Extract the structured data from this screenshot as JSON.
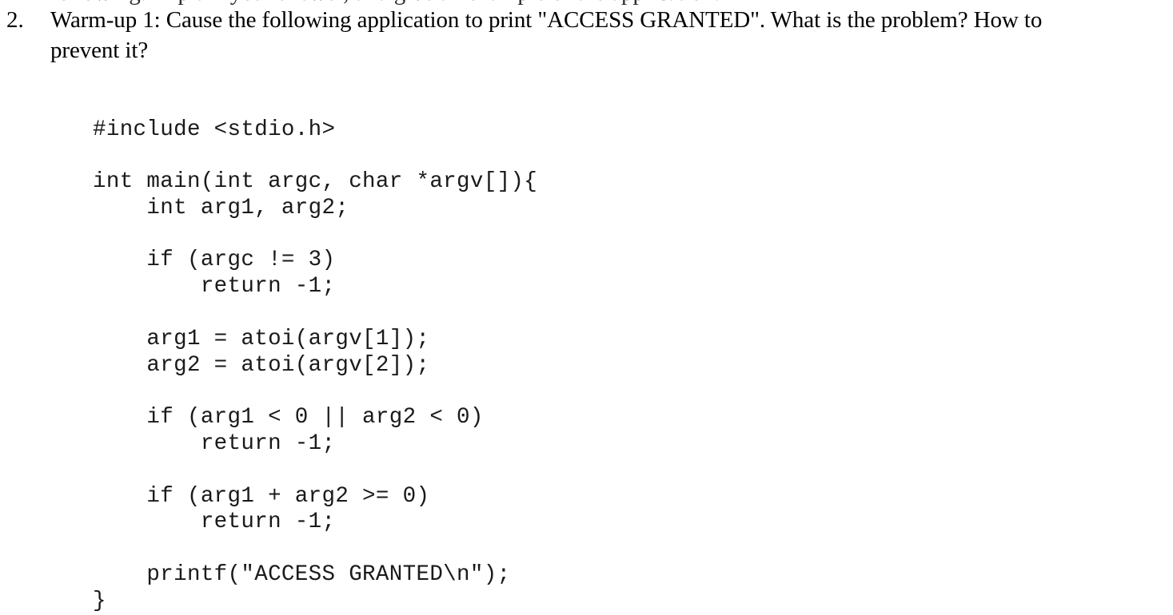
{
  "document": {
    "background_color": "#ffffff",
    "text_color": "#000000",
    "clipped_previous_line": "following. Explain your answer, and give an example of the application."
  },
  "question": {
    "number": "2.",
    "text": "Warm-up 1: Cause the following application to print \"ACCESS GRANTED\". What is the problem? How to prevent it?",
    "line_1": "Warm-up 1: Cause the following application to print \"ACCESS GRANTED\". What is the",
    "line_2": "problem? How to prevent it?"
  },
  "code": {
    "language": "C",
    "lines": [
      "#include <stdio.h>",
      "",
      "int main(int argc, char *argv[]){",
      "    int arg1, arg2;",
      "",
      "    if (argc != 3)",
      "        return -1;",
      "",
      "    arg1 = atoi(argv[1]);",
      "    arg2 = atoi(argv[2]);",
      "",
      "    if (arg1 < 0 || arg2 < 0)",
      "        return -1;",
      "",
      "    if (arg1 + arg2 >= 0)",
      "        return -1;",
      "",
      "    printf(\"ACCESS GRANTED\\n\");",
      "}"
    ]
  }
}
